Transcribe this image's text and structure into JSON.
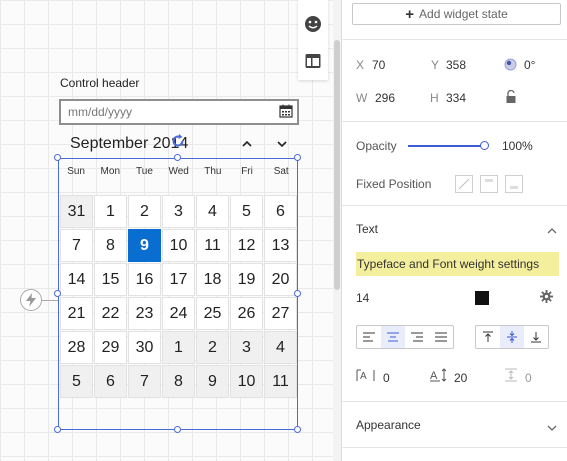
{
  "canvas": {
    "control_header": "Control header",
    "date_placeholder": "mm/dd/yyyy",
    "month_title": "September 2014",
    "weekdays": [
      "Sun",
      "Mon",
      "Tue",
      "Wed",
      "Thu",
      "Fri",
      "Sat"
    ],
    "weeks": [
      [
        {
          "d": "31",
          "other": true
        },
        {
          "d": "1"
        },
        {
          "d": "2"
        },
        {
          "d": "3"
        },
        {
          "d": "4"
        },
        {
          "d": "5"
        },
        {
          "d": "6"
        }
      ],
      [
        {
          "d": "7"
        },
        {
          "d": "8"
        },
        {
          "d": "9",
          "selected": true
        },
        {
          "d": "10"
        },
        {
          "d": "11"
        },
        {
          "d": "12"
        },
        {
          "d": "13"
        }
      ],
      [
        {
          "d": "14"
        },
        {
          "d": "15"
        },
        {
          "d": "16"
        },
        {
          "d": "17"
        },
        {
          "d": "18"
        },
        {
          "d": "19"
        },
        {
          "d": "20"
        }
      ],
      [
        {
          "d": "21"
        },
        {
          "d": "22"
        },
        {
          "d": "23"
        },
        {
          "d": "24"
        },
        {
          "d": "25"
        },
        {
          "d": "26"
        },
        {
          "d": "27"
        }
      ],
      [
        {
          "d": "28"
        },
        {
          "d": "29"
        },
        {
          "d": "30"
        },
        {
          "d": "1",
          "other": true
        },
        {
          "d": "2",
          "other": true
        },
        {
          "d": "3",
          "other": true
        },
        {
          "d": "4",
          "other": true
        }
      ],
      [
        {
          "d": "5",
          "other": true
        },
        {
          "d": "6",
          "other": true
        },
        {
          "d": "7",
          "other": true
        },
        {
          "d": "8",
          "other": true
        },
        {
          "d": "9",
          "other": true
        },
        {
          "d": "10",
          "other": true
        },
        {
          "d": "11",
          "other": true
        }
      ]
    ],
    "selected_color": "#0a6ed1",
    "selection_color": "#4a6bd8"
  },
  "panel": {
    "add_widget_state": "Add widget state",
    "x_label": "X",
    "x_value": "70",
    "y_label": "Y",
    "y_value": "358",
    "rotation_value": "0°",
    "w_label": "W",
    "w_value": "296",
    "h_label": "H",
    "h_value": "334",
    "opacity_label": "Opacity",
    "opacity_value": "100%",
    "opacity_fraction": 1.0,
    "fixed_position_label": "Fixed Position",
    "text_section": "Text",
    "typeface_text": "Typeface and Font weight settings",
    "font_size": "14",
    "text_color": "#111111",
    "char_spacing": "0",
    "line_height": "20",
    "paragraph_spacing": "0",
    "appearance_section": "Appearance",
    "highlight_color": "#f4ef9c",
    "accent_color": "#3f5bd6"
  }
}
